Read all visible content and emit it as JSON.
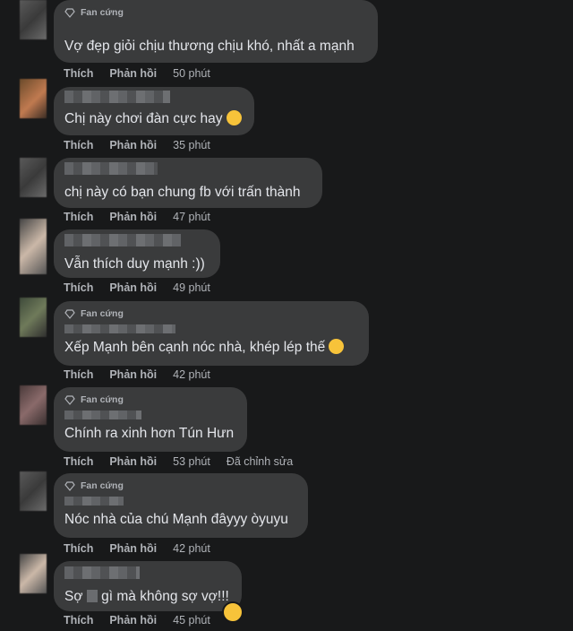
{
  "badge_label": "Fan cứng",
  "actions": {
    "like": "Thích",
    "reply": "Phản hồi",
    "edited": "Đã chỉnh sửa"
  },
  "comments": [
    {
      "text": "Vợ đẹp giỏi chịu thương chịu khó, nhất a mạnh",
      "time": "50 phút"
    },
    {
      "text": "Chị này chơi đàn cực hay",
      "time": "35 phút"
    },
    {
      "text": "chị này có bạn chung fb với trấn thành",
      "time": "47 phút"
    },
    {
      "text": "Vẫn thích duy mạnh :))",
      "time": "49 phút"
    },
    {
      "text": "Xếp Mạnh bên cạnh nóc nhà, khép lép thế",
      "time": "42 phút"
    },
    {
      "text": "Chính ra xinh hơn Tún Hưn",
      "time": "53 phút"
    },
    {
      "text": "Nóc nhà của chú Mạnh đâyyy òyuyu",
      "time": "42 phút"
    },
    {
      "text_before": "Sợ",
      "text_after": "gì mà không sợ vợ!!!",
      "time": "45 phút"
    }
  ],
  "colors": {
    "background": "#18191a",
    "bubble": "#3a3b3c",
    "text": "#e4e6eb",
    "meta": "#b0b3b8"
  },
  "icons": [
    "diamond-icon",
    "smile-emoji-icon",
    "tongue-emoji-icon",
    "laugh-emoji-icon"
  ]
}
